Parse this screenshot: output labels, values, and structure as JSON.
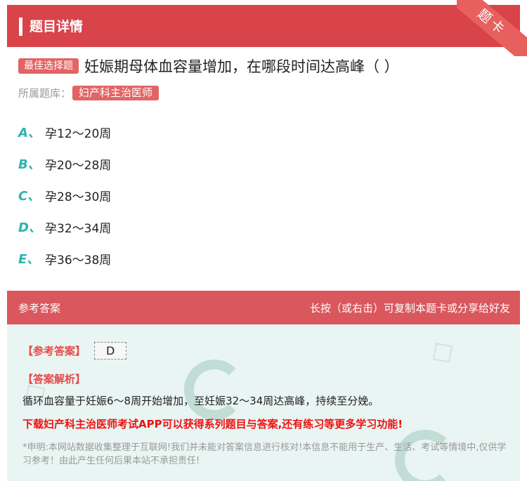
{
  "header": {
    "title": "题目详情",
    "corner_ribbon": "题卡"
  },
  "question": {
    "type_tag": "最佳选择题",
    "text": "妊娠期母体血容量增加，在哪段时间达高峰（ ）",
    "library_label": "所属题库：",
    "library_name": "妇产科主治医师"
  },
  "options": [
    {
      "letter": "A、",
      "text": "孕12～20周"
    },
    {
      "letter": "B、",
      "text": "孕20～28周"
    },
    {
      "letter": "C、",
      "text": "孕28～30周"
    },
    {
      "letter": "D、",
      "text": "孕32～34周"
    },
    {
      "letter": "E、",
      "text": "孕36～38周"
    }
  ],
  "answer_section": {
    "header_left": "参考答案",
    "header_right": "长按（或右击）可复制本题卡或分享给好友",
    "ref_label": "【参考答案】",
    "ref_value": "D",
    "analysis_label": "【答案解析】",
    "analysis_text": "循环血容量于妊娠6～8周开始增加，至妊娠32～34周达高峰，持续至分娩。",
    "promo": "下载妇产科主治医师考试APP可以获得系列题目与答案,还有练习等更多学习功能!",
    "disclaimer": "*申明:本网站数据收集整理于互联网!我们并未能对答案信息进行核对!本信息不能用于生产、生活、考试等情境中,仅供学习参考！由此产生任何后果本站不承担责任!"
  },
  "colors": {
    "header_red": "#d9434a",
    "accent_teal": "#2db3b0",
    "answer_bg": "#e9f5f2"
  }
}
